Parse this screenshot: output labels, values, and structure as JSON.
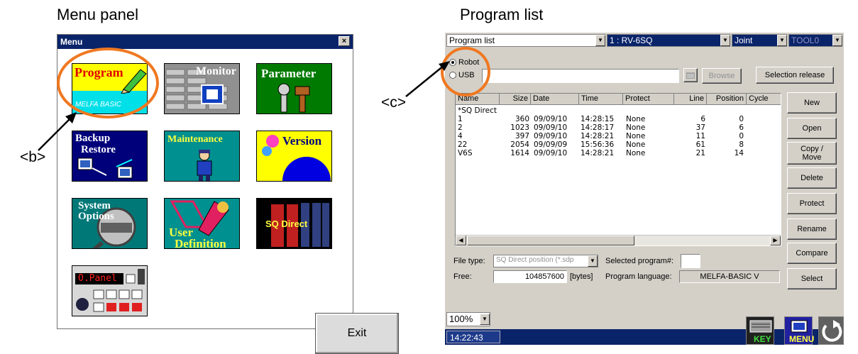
{
  "captions": {
    "menu_panel": "Menu panel",
    "program_list": "Program list"
  },
  "callouts": {
    "b": "<b>",
    "c": "<c>"
  },
  "colors": {
    "highlight_ring": "#f07820",
    "title_bar": "#0a246a"
  },
  "menu": {
    "title": "Menu",
    "close": "×",
    "tiles": {
      "program": "Program",
      "program_sub": "MELFA BASIC",
      "monitor": "Monitor",
      "parameter": "Parameter",
      "backup_1": "Backup",
      "backup_2": "Restore",
      "maintenance": "Maintenance",
      "version": "Version",
      "system_1": "System",
      "system_2": "Options",
      "user_1": "User",
      "user_2": "Definition",
      "sq_direct": "SQ Direct",
      "opanel": "O.Panel"
    },
    "exit": "Exit"
  },
  "plist": {
    "combo_list": "Program list",
    "combo_robot": "1 : RV-6SQ",
    "combo_frame": "Joint",
    "combo_tool": "TOOL0",
    "radio_robot": "Robot",
    "radio_usb": "USB",
    "browse": "Browse",
    "selection_release": "Selection release",
    "columns": [
      "Name",
      "Size",
      "Date",
      "Time",
      "Protect",
      "Line",
      "Position",
      "Cycle"
    ],
    "rows": [
      {
        "name": "*SQ Direct",
        "size": "",
        "date": "",
        "time": "",
        "protect": "",
        "line": "",
        "position": ""
      },
      {
        "name": "1",
        "size": "360",
        "date": "09/09/10",
        "time": "14:28:15",
        "protect": "None",
        "line": "6",
        "position": "0"
      },
      {
        "name": "2",
        "size": "1023",
        "date": "09/09/10",
        "time": "14:28:17",
        "protect": "None",
        "line": "37",
        "position": "6"
      },
      {
        "name": "4",
        "size": "397",
        "date": "09/09/10",
        "time": "14:28:21",
        "protect": "None",
        "line": "11",
        "position": "0"
      },
      {
        "name": "22",
        "size": "2054",
        "date": "09/09/09",
        "time": "15:56:36",
        "protect": "None",
        "line": "61",
        "position": "8"
      },
      {
        "name": "V6S",
        "size": "1614",
        "date": "09/09/10",
        "time": "14:28:21",
        "protect": "None",
        "line": "21",
        "position": "14"
      }
    ],
    "buttons": {
      "new": "New",
      "open": "Open",
      "copy_1": "Copy /",
      "copy_2": "Move",
      "delete": "Delete",
      "protect": "Protect",
      "rename": "Rename",
      "compare": "Compare",
      "select": "Select"
    },
    "file_type_label": "File type:",
    "file_type_value": "SQ Direct position (*.sdp",
    "selected_label": "Selected program#:",
    "free_label": "Free:",
    "free_value": "104857600",
    "free_unit": "[bytes]",
    "lang_label": "Program language:",
    "lang_value": "MELFA-BASIC V",
    "zoom": "100%",
    "time": "14:22:43",
    "key_label": "KEY",
    "menu_label": "MENU"
  }
}
